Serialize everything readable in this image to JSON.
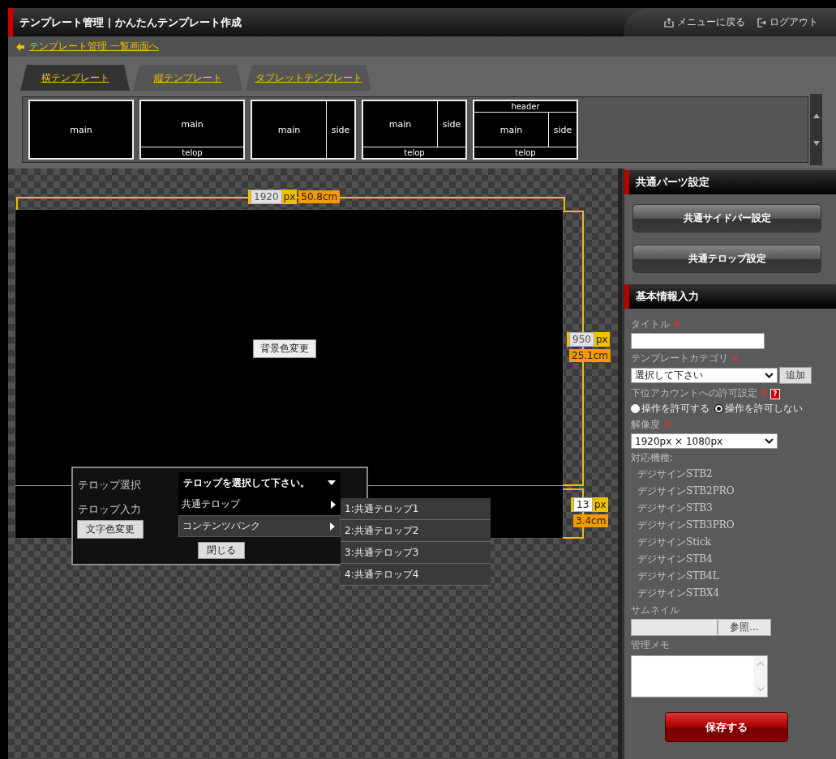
{
  "header": {
    "title": "テンプレート管理 | かんたんテンプレート作成",
    "links": [
      {
        "label": "メニューに戻る",
        "kind": "menu"
      },
      {
        "label": "ログアウト",
        "kind": "logout"
      }
    ]
  },
  "breadcrumb": {
    "label": "テンプレート管理 一覧画面へ"
  },
  "tabs": [
    {
      "label": "横テンプレート",
      "selected": true
    },
    {
      "label": "縦テンプレート",
      "selected": false
    },
    {
      "label": "タブレットテンプレート",
      "selected": false
    }
  ],
  "layouts": [
    {
      "main": "main"
    },
    {
      "main": "main",
      "telop": "telop"
    },
    {
      "main": "main",
      "side": "side"
    },
    {
      "main": "main",
      "side": "side",
      "telop": "telop"
    },
    {
      "header": "header",
      "main": "main",
      "side": "side",
      "telop": "telop"
    }
  ],
  "canvas": {
    "background_button": "背景色変更",
    "width": {
      "value": "1920",
      "unit": "px",
      "cm": "50.8cm",
      "disabled": true
    },
    "height": {
      "value": "950",
      "unit": "px",
      "cm": "25.1cm",
      "disabled": true
    },
    "telop_height": {
      "value": "13",
      "unit": "px",
      "cm": "3.4cm",
      "disabled": false
    }
  },
  "telop_dialog": {
    "select_label": "テロップ選択",
    "input_label": "テロップ入力",
    "color_button": "文字色変更",
    "close_button": "閉じる",
    "dropdown": {
      "placeholder": "テロップを選択して下さい。",
      "items": [
        {
          "label": "共通テロップ",
          "selected": false
        },
        {
          "label": "コンテンツバンク",
          "selected": true
        }
      ]
    },
    "submenu": [
      "1:共通テロップ1",
      "2:共通テロップ2",
      "3:共通テロップ3",
      "4:共通テロップ4"
    ]
  },
  "sidebar": {
    "parts_section": {
      "title": "共通パーツ設定",
      "buttons": [
        "共通サイドバー設定",
        "共通テロップ設定"
      ]
    },
    "info_section": {
      "title": "基本情報入力",
      "title_field": {
        "label": "タイトル",
        "mark": "※"
      },
      "category_field": {
        "label": "テンプレートカテゴリ",
        "mark": "※",
        "value": "選択して下さい",
        "add_button": "追加"
      },
      "permission": {
        "label": "下位アカウントへの許可設定",
        "mark": "※",
        "help": "?",
        "options": [
          {
            "label": "操作を許可する",
            "selected": false
          },
          {
            "label": "操作を許可しない",
            "selected": true
          }
        ]
      },
      "resolution": {
        "label": "解像度",
        "mark": "※",
        "value": "1920px × 1080px"
      },
      "devices_label": "対応機種:",
      "devices": [
        "デジサインSTB2",
        "デジサインSTB2PRO",
        "デジサインSTB3",
        "デジサインSTB3PRO",
        "デジサインStick",
        "デジサインSTB4",
        "デジサインSTB4L",
        "デジサインSTBX4"
      ],
      "thumbnail": {
        "label": "サムネイル",
        "browse_button": "参照..."
      },
      "memo": {
        "label": "管理メモ"
      },
      "save_button": "保存する"
    }
  }
}
